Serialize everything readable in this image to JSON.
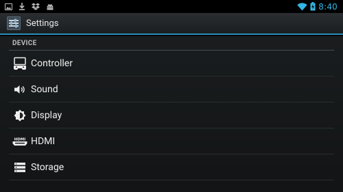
{
  "status_bar": {
    "time": "8:40",
    "left_icons": [
      "image-icon",
      "download-icon",
      "dropbox-icon",
      "android-icon"
    ],
    "right_icons": [
      "wifi-icon",
      "battery-icon"
    ],
    "accent_color": "#33b5e5"
  },
  "action_bar": {
    "title": "Settings",
    "icon": "settings-app-icon",
    "underline_color": "#2b8fb8"
  },
  "section": {
    "header": "DEVICE",
    "items": [
      {
        "label": "Controller",
        "icon": "gamepad-icon"
      },
      {
        "label": "Sound",
        "icon": "speaker-icon"
      },
      {
        "label": "Display",
        "icon": "brightness-icon"
      },
      {
        "label": "HDMI",
        "icon": "hdmi-icon"
      },
      {
        "label": "Storage",
        "icon": "storage-icon"
      }
    ]
  }
}
